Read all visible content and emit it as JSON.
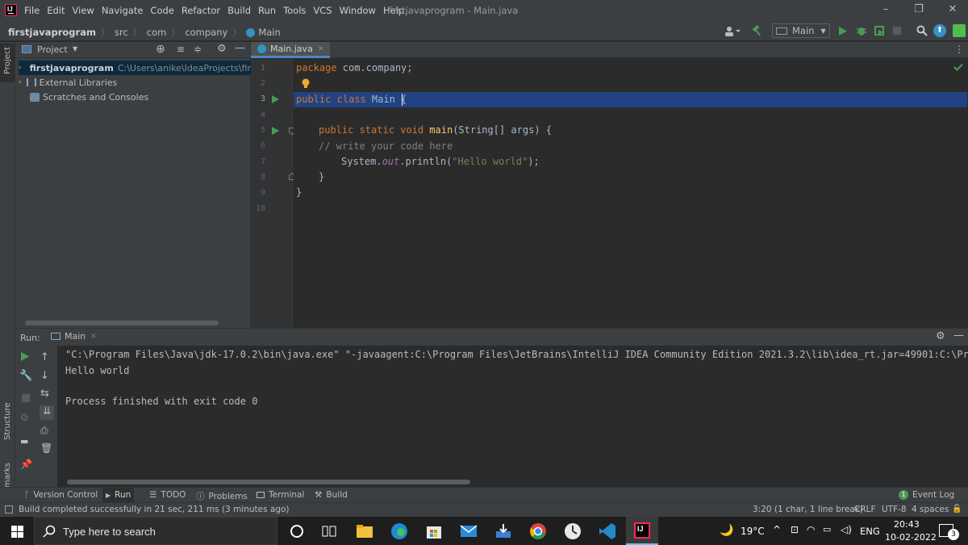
{
  "window": {
    "menu": [
      "File",
      "Edit",
      "View",
      "Navigate",
      "Code",
      "Refactor",
      "Build",
      "Run",
      "Tools",
      "VCS",
      "Window",
      "Help"
    ],
    "title": "firstjavaprogram - Main.java"
  },
  "navbar": {
    "breadcrumbs": [
      "firstjavaprogram",
      "src",
      "com",
      "company",
      "Main"
    ],
    "run_config": "Main"
  },
  "left_strip": {
    "project": "Project",
    "structure": "Structure",
    "bookmarks": "Bookmarks"
  },
  "project_panel": {
    "title": "Project",
    "items": [
      {
        "label": "firstjavaprogram",
        "path": "C:\\Users\\anike\\IdeaProjects\\firstjava"
      },
      {
        "label": "External Libraries"
      },
      {
        "label": "Scratches and Consoles"
      }
    ]
  },
  "editor": {
    "tab": "Main.java",
    "line_numbers": [
      "1",
      "2",
      "3",
      "4",
      "5",
      "6",
      "7",
      "8",
      "9",
      "10"
    ],
    "code": {
      "l1_kw": "package",
      "l1_rest": " com.company;",
      "l3_kw": "public class",
      "l3_rest": " Main {",
      "l5_kw": "public static void",
      "l5_fn": "main",
      "l5_rest": "(String[] args) {",
      "l6": "// write your code here",
      "l7_a": "System.",
      "l7_b": "out",
      "l7_c": ".println(",
      "l7_str": "\"Hello world\"",
      "l7_d": ");",
      "l8": "}",
      "l9": "}"
    }
  },
  "run_panel": {
    "label": "Run:",
    "tab": "Main",
    "output": [
      "\"C:\\Program Files\\Java\\jdk-17.0.2\\bin\\java.exe\" \"-javaagent:C:\\Program Files\\JetBrains\\IntelliJ IDEA Community Edition 2021.3.2\\lib\\idea_rt.jar=49901:C:\\Program",
      "Hello world",
      "",
      "Process finished with exit code 0"
    ]
  },
  "bottom_tabs": [
    "Version Control",
    "Run",
    "TODO",
    "Problems",
    "Terminal",
    "Build"
  ],
  "event_log": {
    "count": "1",
    "label": "Event Log"
  },
  "status": {
    "message": "Build completed successfully in 21 sec, 211 ms (3 minutes ago)",
    "position": "3:20 (1 char, 1 line break)",
    "line_sep": "CRLF",
    "encoding": "UTF-8",
    "indent": "4 spaces"
  },
  "taskbar": {
    "search_placeholder": "Type here to search",
    "weather": "19°C",
    "lang": "ENG",
    "time": "20:43",
    "date": "10-02-2022",
    "notifications": "3"
  },
  "colors": {
    "accent_blue": "#3592c4",
    "run_green": "#499c54",
    "selection": "#214283",
    "keyword": "#cc7832",
    "string": "#6a8759"
  },
  "icons": [
    "ij-logo",
    "folder-icon",
    "gear-icon",
    "run-icon",
    "debug-icon",
    "build-hammer-icon",
    "search-icon",
    "bulb-icon",
    "checkmark-icon",
    "windows-start-icon"
  ]
}
